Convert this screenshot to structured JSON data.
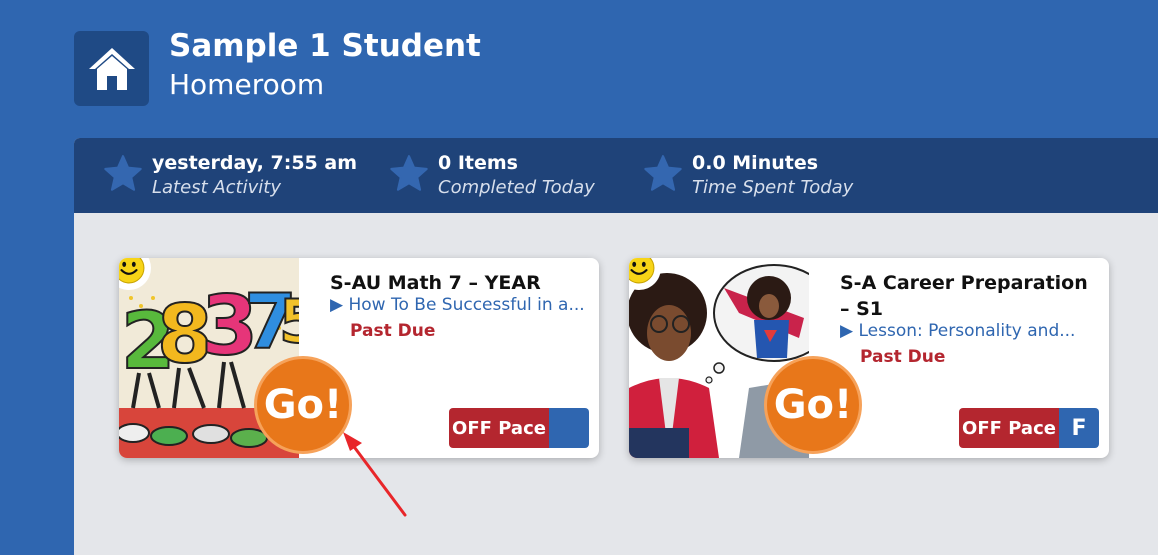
{
  "header": {
    "student_name": "Sample 1 Student",
    "section": "Homeroom",
    "home_icon": "home-icon"
  },
  "stats": [
    {
      "icon": "star-icon",
      "value": "yesterday, 7:55 am",
      "label": "Latest Activity"
    },
    {
      "icon": "star-icon",
      "value": "0 Items",
      "label": "Completed Today"
    },
    {
      "icon": "star-icon",
      "value": "0.0 Minutes",
      "label": "Time Spent Today"
    }
  ],
  "courses": [
    {
      "title": "S-AU Math 7 – YEAR",
      "lesson": "How To Be Successful in a...",
      "status": "Past Due",
      "go_label": "Go!",
      "pace_label": "OFF Pace",
      "grade": ""
    },
    {
      "title": "S-A Career Preparation – S1",
      "lesson": "Lesson: Personality and...",
      "status": "Past Due",
      "go_label": "Go!",
      "pace_label": "OFF Pace",
      "grade": "F"
    }
  ],
  "colors": {
    "header_blue": "#2f66b0",
    "stats_bar": "#1f4379",
    "off_pace_red": "#b4262f",
    "go_orange": "#e8771a",
    "annotation_arrow": "#e8262a"
  }
}
